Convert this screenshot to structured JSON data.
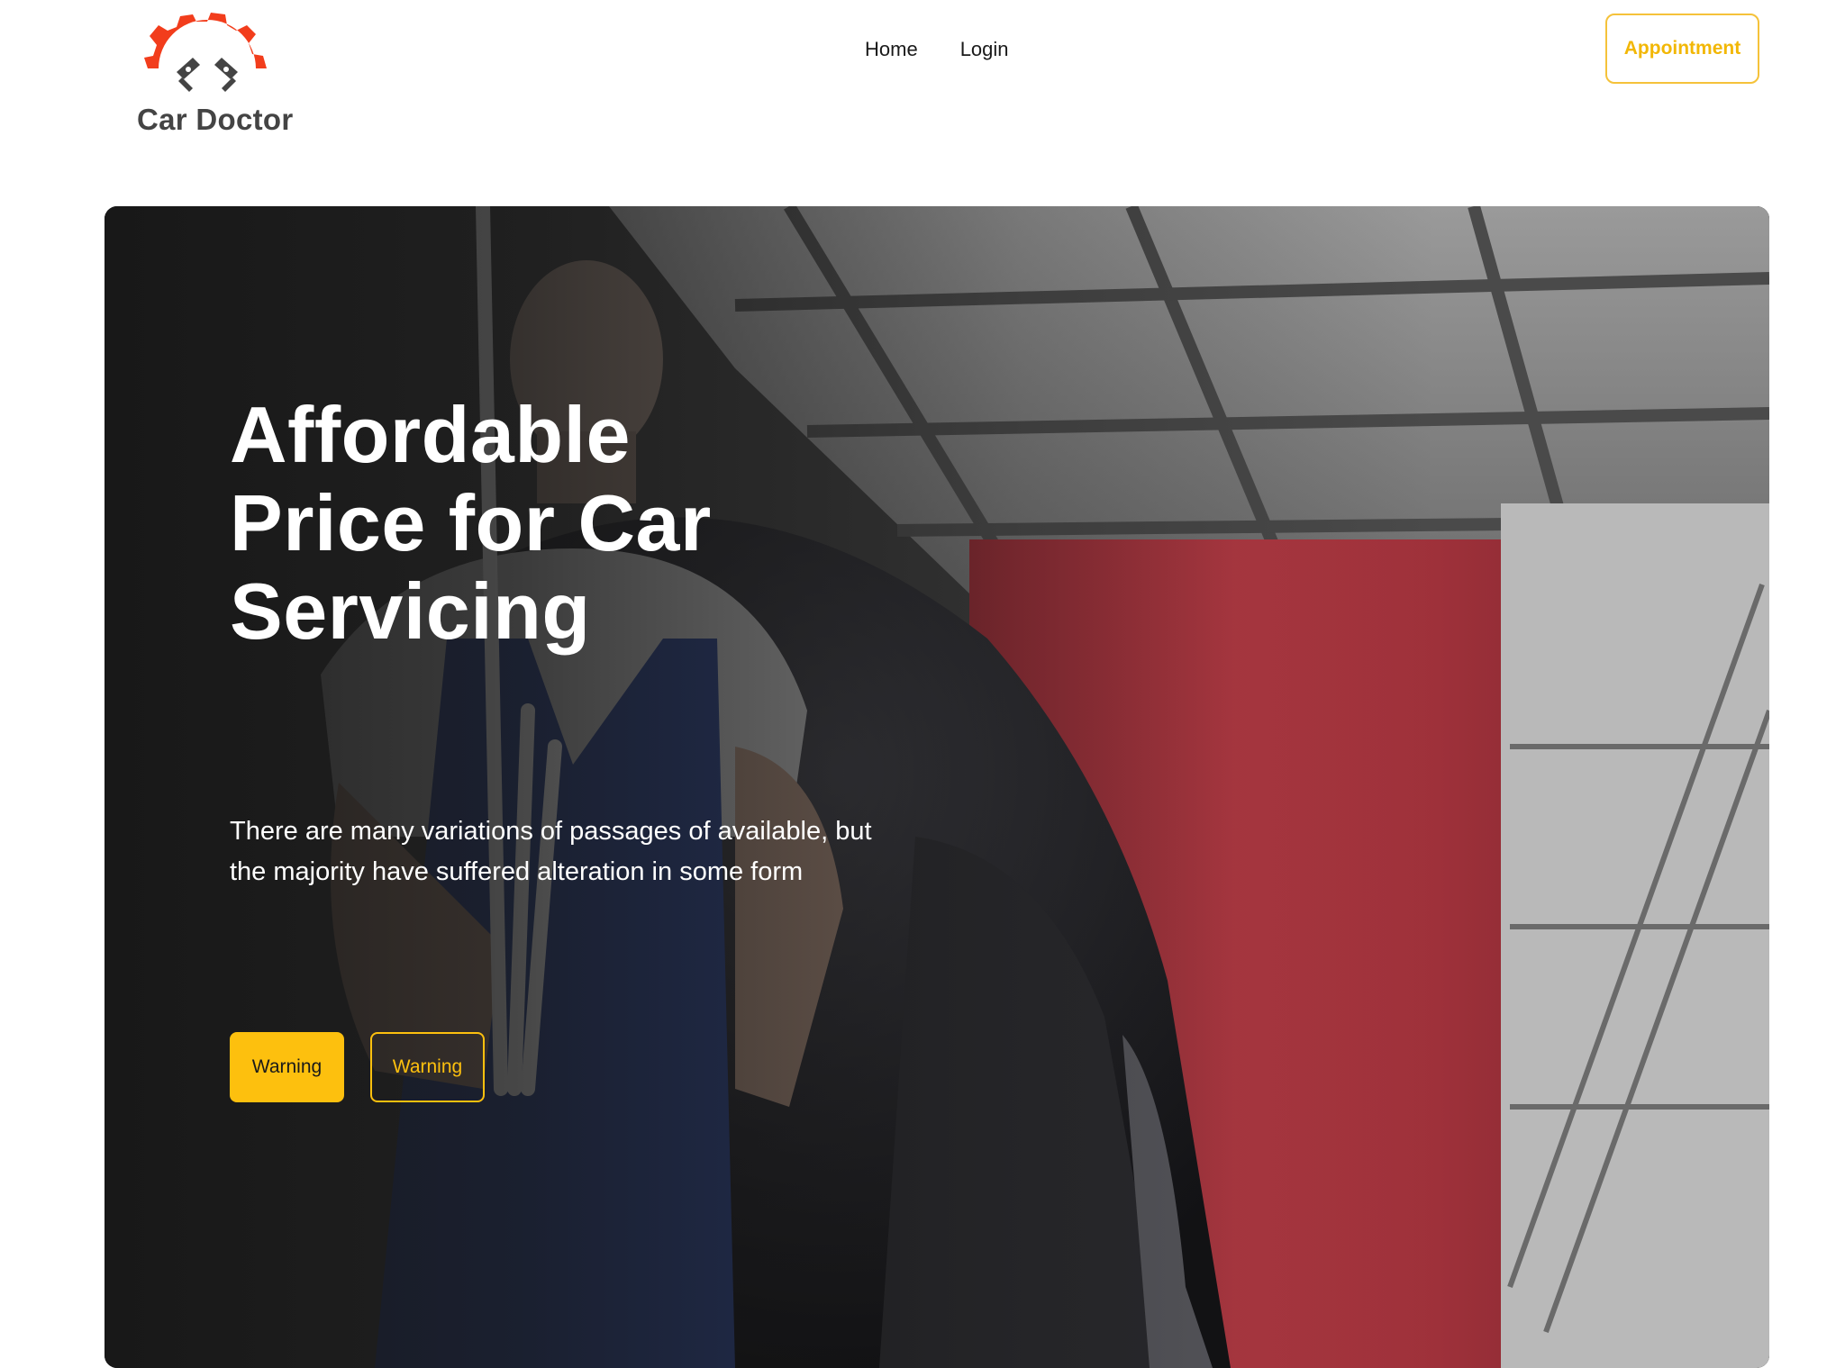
{
  "brand": {
    "name": "Car Doctor",
    "logo_icon": "gear-pistons-icon",
    "gear_color": "#f23d1c",
    "piston_color": "#444444"
  },
  "nav": {
    "items": [
      {
        "label": "Home"
      },
      {
        "label": "Login"
      }
    ],
    "appointment_label": "Appointment"
  },
  "hero": {
    "title": "Affordable Price for Car Servicing",
    "description": "There are many variations of passages of available, but the majority have suffered alteration in some form",
    "primary_button": "Warning",
    "secondary_button": "Warning"
  },
  "colors": {
    "accent": "#fdc00e",
    "accent_outline": "#f5c23a",
    "hero_overlay": "#151515"
  }
}
